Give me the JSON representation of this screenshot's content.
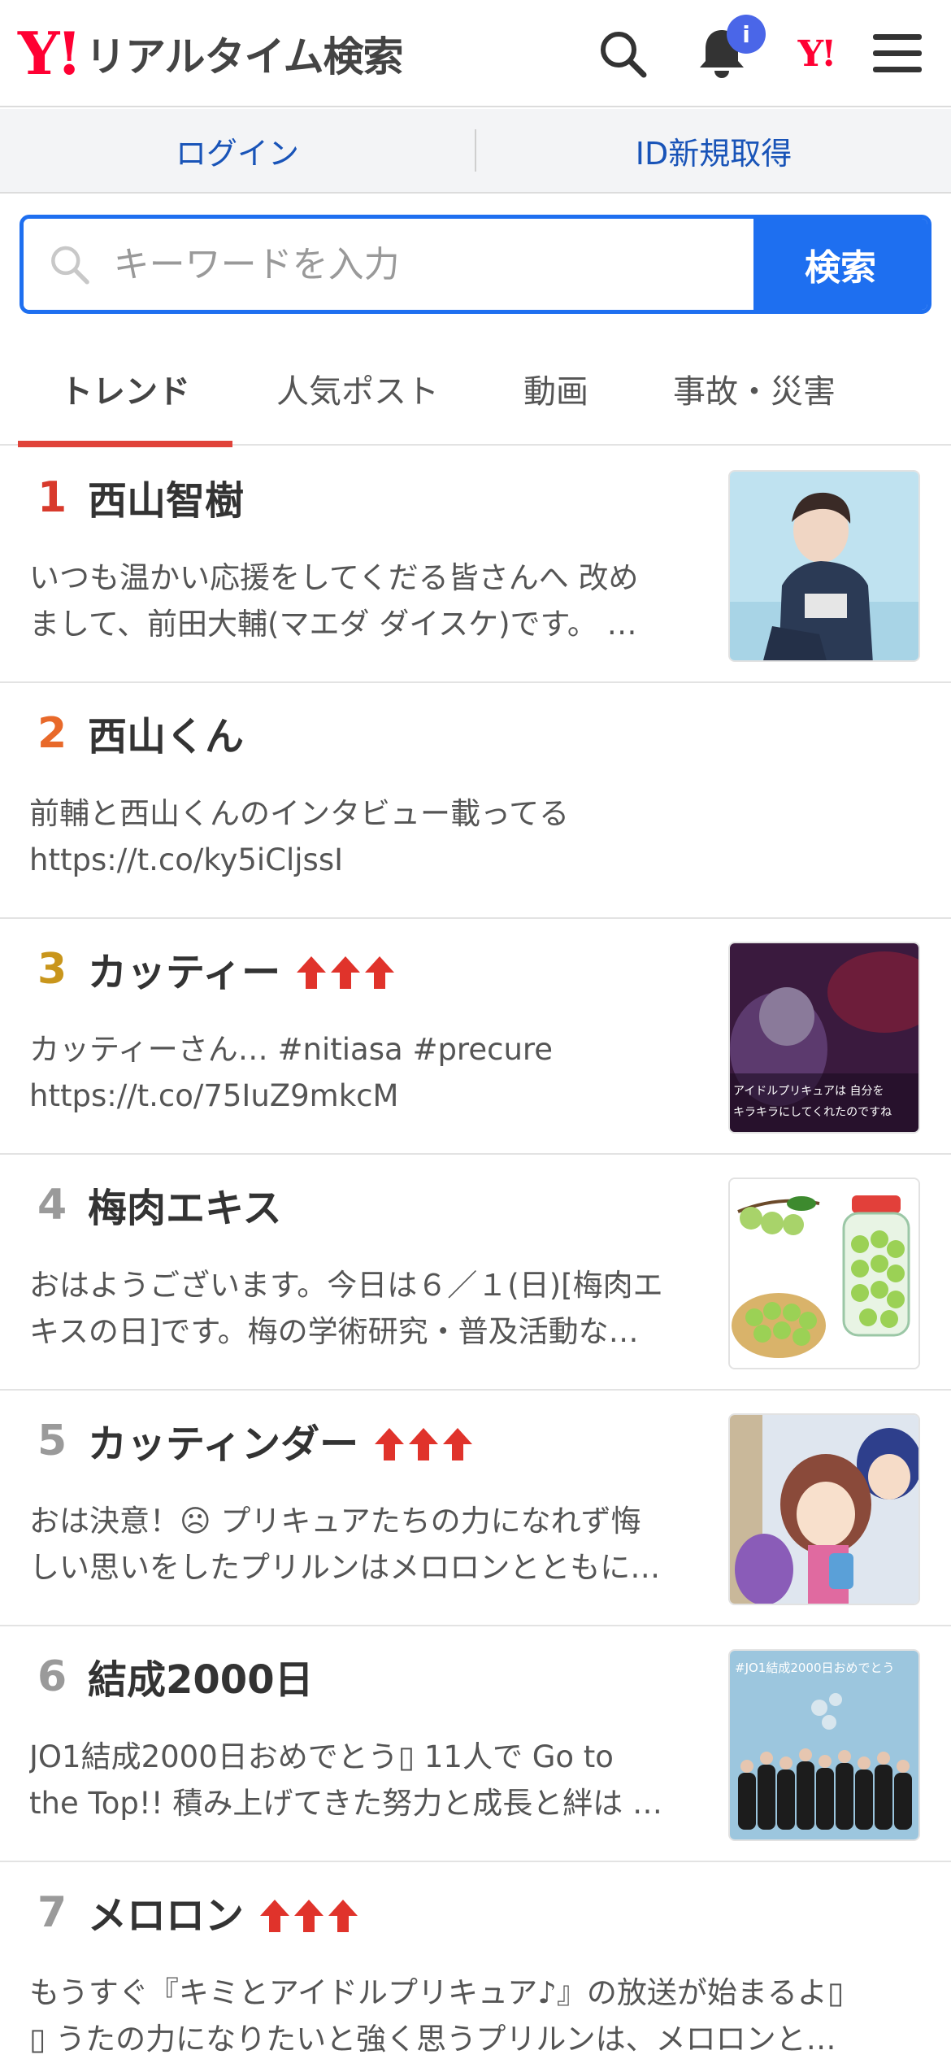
{
  "header": {
    "logo_mark": "Y!",
    "logo_text": "リアルタイム検索",
    "notification_badge": "i",
    "yahoo_mark": "Y!"
  },
  "loginbar": {
    "login": "ログイン",
    "signup": "ID新規取得"
  },
  "search": {
    "placeholder": "キーワードを入力",
    "value": "",
    "submit": "検索"
  },
  "tabs": [
    "トレンド",
    "人気ポスト",
    "動画",
    "事故・災害"
  ],
  "colors": {
    "accent_blue": "#1e6ff0",
    "brand_red": "#ff0033",
    "rank1": "#d83a2c",
    "rank2": "#e8692a",
    "rank3": "#c9961c",
    "rank_other": "#9a9a9a",
    "trend_arrow": "#e0332b"
  },
  "trends": [
    {
      "rank": "1",
      "title": "西山智樹",
      "rising": false,
      "desc": [
        "いつも温かい応援をしてくだる皆さんへ 改め",
        "まして、前田大輔(マエダ ダイスケ)です。 …"
      ],
      "thumb": "photo-person"
    },
    {
      "rank": "2",
      "title": "西山くん",
      "rising": false,
      "desc": [
        "前輔と西山くんのインタビュー載ってる",
        "https://t.co/ky5iCljssI"
      ],
      "thumb": null
    },
    {
      "rank": "3",
      "title": "カッティー",
      "rising": true,
      "desc": [
        "カッティーさん… #nitiasa #precure",
        "https://t.co/75IuZ9mkcM"
      ],
      "thumb": "anime-scene",
      "thumb_caption": [
        "アイドルプリキュアは 自分を",
        "キラキラにしてくれたのですね"
      ]
    },
    {
      "rank": "4",
      "title": "梅肉エキス",
      "rising": false,
      "desc": [
        "おはようございます。今日は６／１(日)[梅肉エ",
        "キスの日]です。梅の学術研究・普及活動な…"
      ],
      "thumb": "ume-illustration"
    },
    {
      "rank": "5",
      "title": "カッティンダー",
      "rising": true,
      "desc": [
        "おは決意！☹ プリキュアたちの力になれず悔",
        "しい思いをしたプリルンはメロロンとともに…"
      ],
      "thumb": "anime-girls"
    },
    {
      "rank": "6",
      "title": "結成2000日",
      "rising": false,
      "desc": [
        "JO1結成2000日おめでとう▯ 11人で Go to",
        "the Top!! 積み上げてきた努力と成長と絆は …"
      ],
      "thumb": "group-photo",
      "thumb_caption": [
        "#JO1結成2000日おめでとう"
      ]
    },
    {
      "rank": "7",
      "title": "メロロン",
      "rising": true,
      "desc": [
        "もうすぐ『キミとアイドルプリキュア♪』の放送が始まるよ▯",
        "▯ うたの力になりたいと強く思うプリルンは、メロロンと…"
      ],
      "thumb": null
    }
  ]
}
